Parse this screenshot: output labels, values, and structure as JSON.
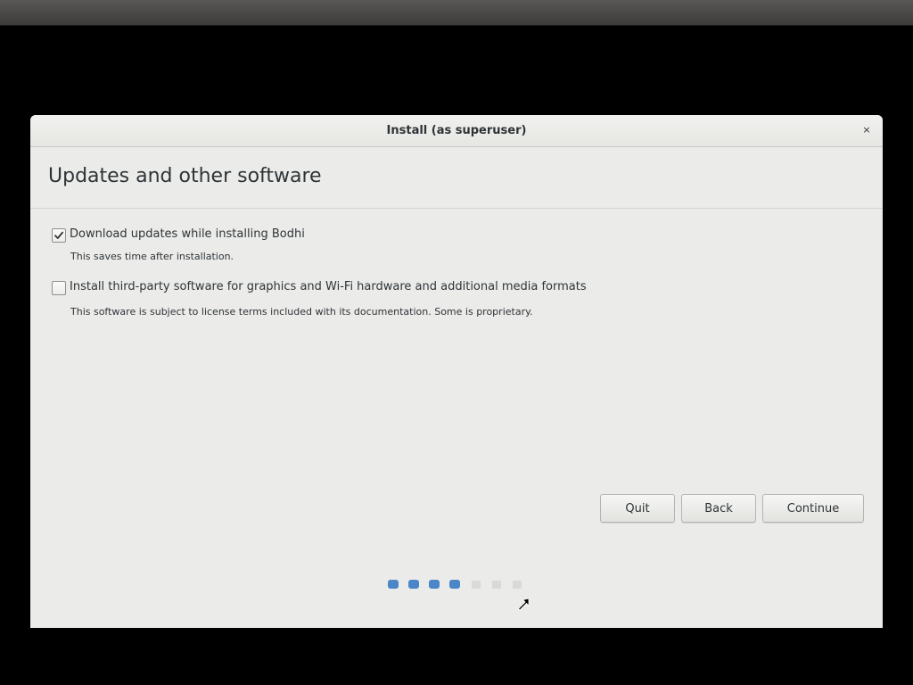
{
  "window": {
    "title": "Install (as superuser)",
    "close_glyph": "×"
  },
  "page": {
    "title": "Updates and other software"
  },
  "options": [
    {
      "label": "Download updates while installing Bodhi",
      "description": "This saves time after installation.",
      "checked": true
    },
    {
      "label": "Install third-party software for graphics and Wi-Fi hardware and additional media formats",
      "description": "This software is subject to license terms included with its documentation. Some is proprietary.",
      "checked": false
    }
  ],
  "buttons": {
    "quit": "Quit",
    "back": "Back",
    "continue": "Continue"
  },
  "progress": {
    "completed_steps": 4,
    "total_steps": 7
  },
  "colors": {
    "accent": "#4a86c8",
    "window_bg": "#ebebea",
    "text": "#2e3436"
  }
}
